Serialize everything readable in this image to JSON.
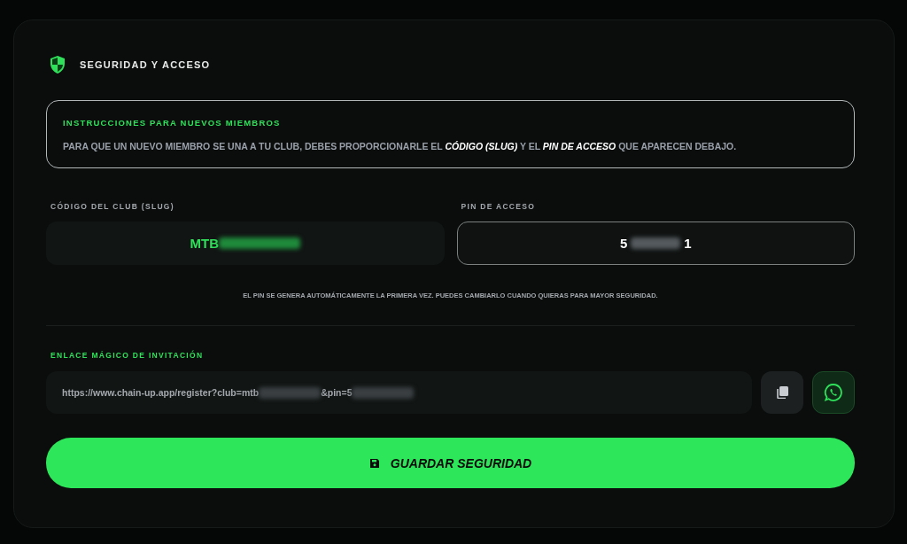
{
  "header": {
    "title": "SEGURIDAD Y ACCESO"
  },
  "instructions": {
    "title": "INSTRUCCIONES PARA NUEVOS MIEMBROS",
    "text": "PARA QUE UN NUEVO MIEMBRO SE UNA A TU CLUB, DEBES PROPORCIONARLE EL **CÓDIGO (SLUG)** Y EL **PIN DE ACCESO** QUE APARECEN DEBAJO."
  },
  "fields": [
    {
      "label": "CÓDIGO DEL CLUB (SLUG)",
      "kind": "slug",
      "parts": [
        {
          "kind": "text",
          "text": "MTB"
        },
        {
          "kind": "blur"
        }
      ]
    },
    {
      "label": "PIN DE ACCESO",
      "kind": "pin",
      "parts": [
        {
          "kind": "text",
          "text": "5"
        },
        {
          "kind": "blur"
        },
        {
          "kind": "text",
          "text": "1"
        }
      ]
    }
  ],
  "note": "EL PIN SE GENERA AUTOMÁTICAMENTE LA PRIMERA VEZ. PUEDES CAMBIARLO CUANDO QUIERAS PARA MAYOR SEGURIDAD.",
  "invite": {
    "label": "ENLACE MÁGICO DE INVITACIÓN",
    "parts": [
      {
        "kind": "text",
        "text": "https://www.chain-up.app/register?club=mtb"
      },
      {
        "kind": "blur"
      },
      {
        "kind": "text",
        "text": "&pin=5"
      },
      {
        "kind": "blur"
      }
    ]
  },
  "save_button": {
    "label": "GUARDAR SEGURIDAD"
  }
}
